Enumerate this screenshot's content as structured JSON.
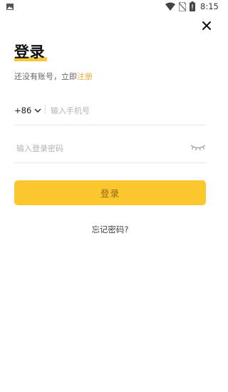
{
  "status_bar": {
    "time": "8:15",
    "icons": [
      "image-icon",
      "wifi-icon",
      "no-sim-icon",
      "battery-icon"
    ]
  },
  "header": {
    "close_icon": "close-icon",
    "title": "登录",
    "accent_color": "#f7c83a"
  },
  "subtitle": {
    "prefix": "还没有账号，立即",
    "register_link": "注册",
    "link_color": "#e8a93b"
  },
  "phone": {
    "country_code": "+86",
    "placeholder": "输入手机号"
  },
  "password": {
    "placeholder": "输入登录密码",
    "toggle_icon": "eye-closed-icon"
  },
  "login_button": {
    "label": "登录",
    "color": "#fcc62f"
  },
  "forgot_password": "忘记密码?"
}
